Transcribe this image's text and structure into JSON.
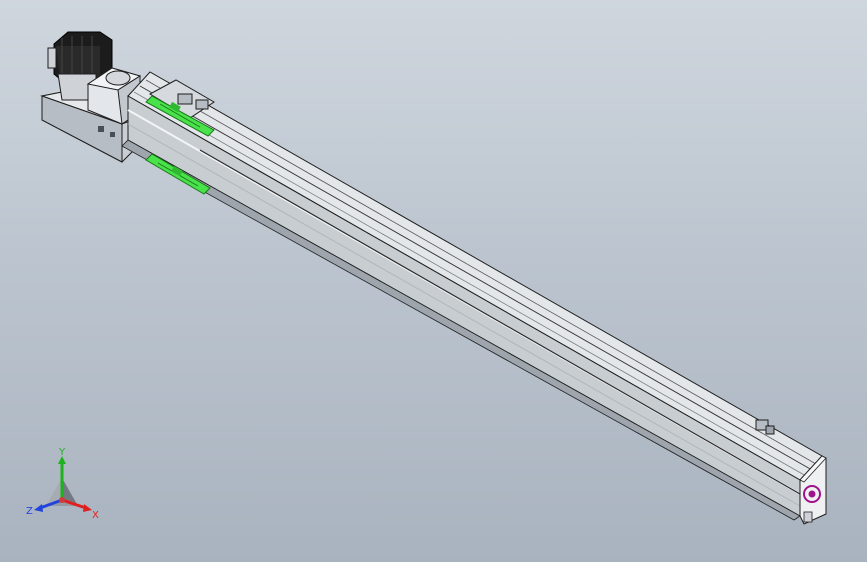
{
  "viewport": {
    "background_top": "#cfd6de",
    "background_bottom": "#a9b3bf"
  },
  "model": {
    "rail_color": "#d9dde2",
    "rail_shadow": "#9ea5ad",
    "edge_color": "#1e1e1e",
    "highlight_green": "#49e24a",
    "motor_color": "#1c1c1c",
    "end_logo_color": "#a0128c"
  },
  "triad": {
    "x_label": "X",
    "y_label": "Y",
    "z_label": "Z",
    "x_color": "#e0201c",
    "y_color": "#1fb21f",
    "z_color": "#2244dd"
  }
}
